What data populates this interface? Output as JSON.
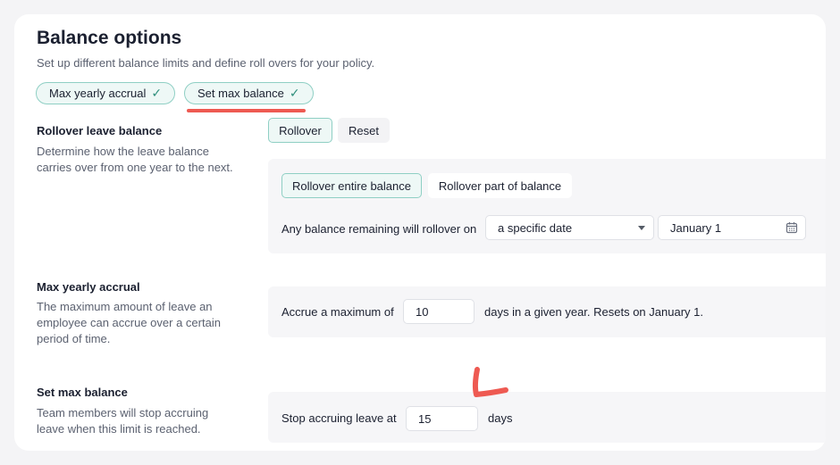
{
  "header": {
    "title": "Balance options",
    "subtitle": "Set up different balance limits and define roll overs for your policy."
  },
  "chips": [
    {
      "label": "Max yearly accrual",
      "icon": "check-icon"
    },
    {
      "label": "Set max balance",
      "icon": "check-icon"
    }
  ],
  "rollover": {
    "title": "Rollover leave balance",
    "description": "Determine how the leave balance carries over from one year to the next.",
    "tabs": {
      "rollover": "Rollover",
      "reset": "Reset"
    },
    "options": {
      "entire": "Rollover entire balance",
      "part": "Rollover part of balance"
    },
    "rule_label": "Any balance remaining will rollover on",
    "when_select": "a specific date",
    "date_value": "January 1"
  },
  "max_accrual": {
    "title": "Max yearly accrual",
    "description": "The maximum amount of leave an employee can accrue over a certain period of time.",
    "prefix": "Accrue a maximum of",
    "value": "10",
    "suffix": "days in a given year. Resets on January 1."
  },
  "max_balance": {
    "title": "Set max balance",
    "description": "Team members will stop accruing leave when this limit is reached.",
    "prefix": "Stop accruing leave at",
    "value": "15",
    "suffix": "days"
  },
  "colors": {
    "accent_border": "#8fcfc4",
    "accent_bg": "#eef8f6",
    "check": "#2f8f7c",
    "annotation": "#ee5a52"
  }
}
